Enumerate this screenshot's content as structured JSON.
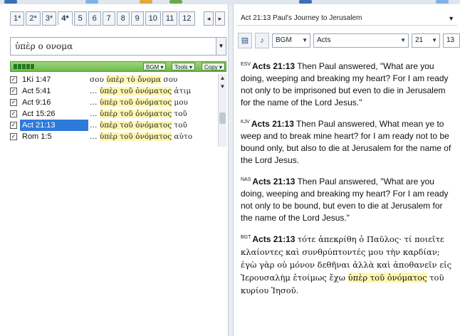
{
  "left": {
    "tabs": [
      "1*",
      "2*",
      "3*",
      "4*",
      "5",
      "6",
      "7",
      "8",
      "9",
      "10",
      "11",
      "12"
    ],
    "active_tab": "4*",
    "search": {
      "value": "ὑπὲρ ο ονομα"
    },
    "result_bar": {
      "bgm_label": "BGM ▾",
      "tools_label": "Tools ▾",
      "copy_label": "Copy ▾"
    },
    "results": [
      {
        "ref": "1Ki 1:47",
        "prefix": "σου ",
        "match": "ὑπὲρ τὸ ὄνομα",
        "suffix": " σου"
      },
      {
        "ref": "Act 5:41",
        "prefix": "… ",
        "match": "ὑπὲρ τοῦ ὀνόματος",
        "suffix": " ἀτιμ"
      },
      {
        "ref": "Act 9:16",
        "prefix": "… ",
        "match": "ὑπὲρ τοῦ ὀνόματος",
        "suffix": " μου"
      },
      {
        "ref": "Act 15:26",
        "prefix": "… ",
        "match": "ὑπὲρ τοῦ ὀνόματος",
        "suffix": " τοῦ"
      },
      {
        "ref": "Act 21:13",
        "prefix": "… ",
        "match": "ὑπὲρ τοῦ ὀνόματος",
        "suffix": " τοῦ"
      },
      {
        "ref": "Rom 1:5",
        "prefix": "… ",
        "match": "ὑπὲρ τοῦ ὀνόματος",
        "suffix": " αὐτο"
      }
    ]
  },
  "right": {
    "title": "Act 21:13 Paul's Journey to Jerusalem",
    "version_select": "BGM",
    "book_select": "Acts",
    "chapter_select": "21",
    "verse_select": "13",
    "verses": [
      {
        "version": "ESV",
        "ref": "Acts 21:13",
        "text": "Then Paul answered, \"What are you doing, weeping and breaking my heart? For I am ready not only to be imprisoned but even to die in Jerusalem for the name of the Lord Jesus.\""
      },
      {
        "version": "KJV",
        "ref": "Acts 21:13",
        "text": "Then Paul answered, What mean ye to weep and to break mine heart? for I am ready not to be bound only, but also to die at Jerusalem for the name of the Lord Jesus."
      },
      {
        "version": "NAS",
        "ref": "Acts 21:13",
        "text": "Then Paul answered, \"What are you doing, weeping and breaking my heart? For I am ready not only to be bound, but even to die at Jerusalem for the name of the Lord Jesus.\""
      },
      {
        "version": "BGT",
        "ref": "Acts 21:13",
        "prefix": "τότε ἀπεκρίθη ὁ Παῦλος· τί ποιεῖτε κλαίοντες καὶ συνθρύπτοντές μου τὴν καρδίαν; ἐγὼ γὰρ οὐ μόνον δεθῆναι ἀλλὰ καὶ ἀποθανεῖν εἰς Ἰερουσαλὴμ ἑτοίμως ἔχω ",
        "match": "ὑπὲρ τοῦ ὀνόματος",
        "suffix": " τοῦ κυρίου Ἰησοῦ."
      }
    ]
  },
  "colors": {
    "selection": "#2f7ad8",
    "highlight": "#fff7b0",
    "result_bar": "#6dbb4a"
  }
}
